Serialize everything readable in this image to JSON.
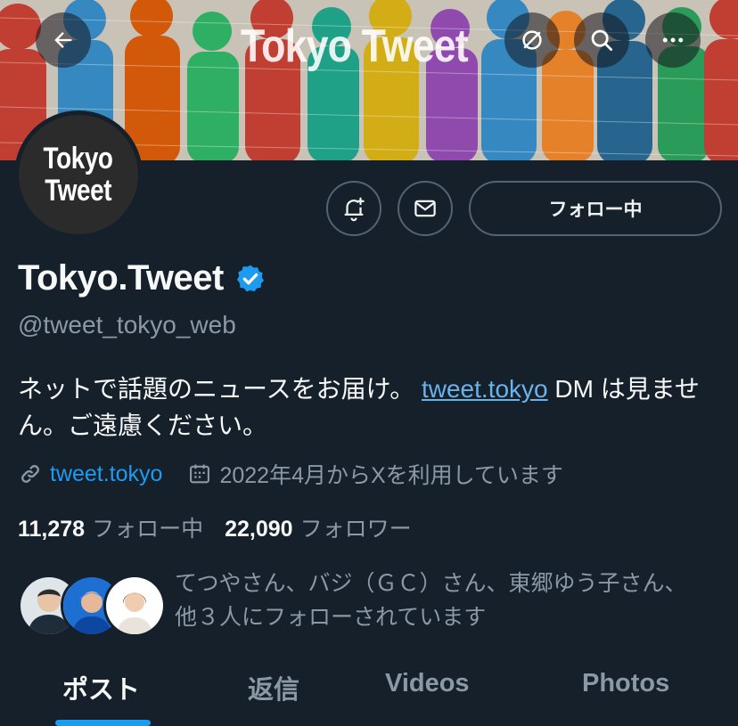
{
  "header": {
    "banner_title": "Tokyo Tweet",
    "back_icon": "back-arrow-icon",
    "actions": [
      "refresh-icon",
      "search-icon",
      "more-icon"
    ]
  },
  "profile": {
    "avatar_line1": "Tokyo",
    "avatar_line2": "Tweet",
    "display_name": "Tokyo.Tweet",
    "verified": true,
    "handle": "@tweet_tokyo_web",
    "bio_text": "ネットで話題のニュースをお届け。",
    "bio_link": "tweet.tokyo",
    "bio_after_link": "DM は見ません。ご遠慮ください。",
    "website": "tweet.tokyo",
    "joined": "2022年4月からXを利用しています"
  },
  "buttons": {
    "follow_label": "フォロー中"
  },
  "stats": {
    "following_count": "11,278",
    "following_label": "フォロー中",
    "followers_count": "22,090",
    "followers_label": "フォロワー"
  },
  "mutual": {
    "line1": "てつやさん、バジ（ＧＣ）さん、東郷ゆう子さん、",
    "line2": "他３人にフォローされています"
  },
  "tabs": [
    {
      "label": "ポスト",
      "active": true
    },
    {
      "label": "返信",
      "active": false
    },
    {
      "label": "Videos",
      "active": false
    },
    {
      "label": "Photos",
      "active": false
    }
  ],
  "colors": {
    "background": "#15202b",
    "accent": "#1d9bf0",
    "verified": "#1d9bf0",
    "secondary_text": "#8b98a5"
  }
}
